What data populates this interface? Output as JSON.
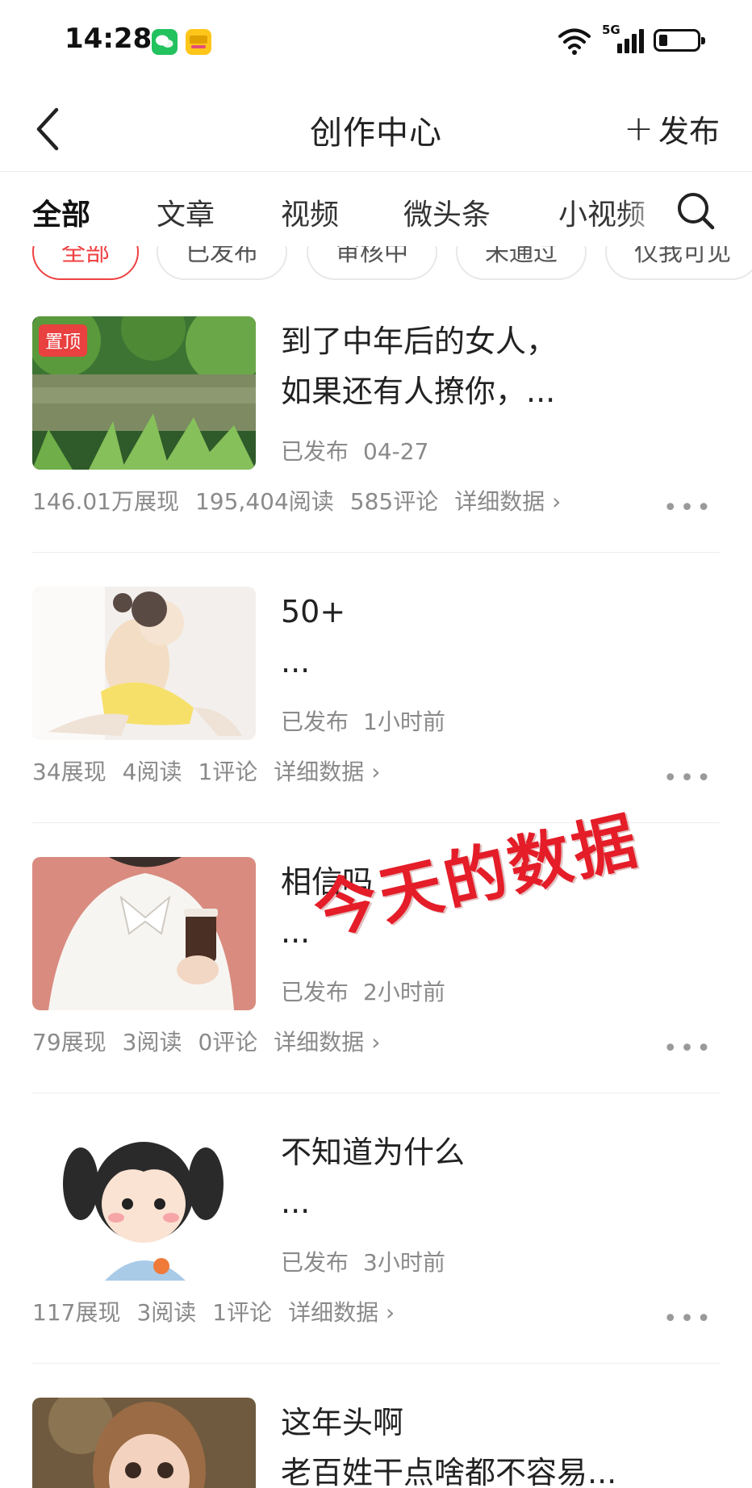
{
  "status_bar": {
    "time": "14:28",
    "network": "5G",
    "apps": [
      "wechat-icon",
      "meituan-icon"
    ]
  },
  "header": {
    "title": "创作中心",
    "publish_label": "发布",
    "back_icon": "chevron-left-icon"
  },
  "tabs": [
    {
      "label": "全部",
      "active": true
    },
    {
      "label": "文章"
    },
    {
      "label": "视频"
    },
    {
      "label": "微头条"
    },
    {
      "label": "小视频"
    }
  ],
  "filters": [
    {
      "label": "全部",
      "active": true
    },
    {
      "label": "已发布"
    },
    {
      "label": "审核中"
    },
    {
      "label": "未通过"
    },
    {
      "label": "仅我可见"
    }
  ],
  "articles": [
    {
      "pinned": true,
      "pinned_label": "置顶",
      "title_line1": "到了中年后的女人，",
      "title_line2": "如果还有人撩你，...",
      "status": "已发布",
      "time": "04-27",
      "impressions": "146.01万展现",
      "reads": "195,404阅读",
      "comments": "585评论",
      "detail": "详细数据",
      "thumb": "lake-trees-photo"
    },
    {
      "title_line1": "50+",
      "title_line2": "...",
      "status": "已发布",
      "time": "1小时前",
      "impressions": "34展现",
      "reads": "4阅读",
      "comments": "1评论",
      "detail": "详细数据",
      "thumb": "yoga-girl-illustration"
    },
    {
      "title_line1": "相信吗",
      "title_line2": "...",
      "status": "已发布",
      "time": "2小时前",
      "impressions": "79展现",
      "reads": "3阅读",
      "comments": "0评论",
      "detail": "详细数据",
      "thumb": "coffee-girl-illustration"
    },
    {
      "title_line1": "不知道为什么",
      "title_line2": "...",
      "status": "已发布",
      "time": "3小时前",
      "impressions": "117展现",
      "reads": "3阅读",
      "comments": "1评论",
      "detail": "详细数据",
      "thumb": "pigtail-girl-illustration"
    },
    {
      "title_line1": "这年头啊",
      "title_line2": "老百姓干点啥都不容易...",
      "thumb": "girl-portrait-illustration"
    }
  ],
  "overlay_text": "今天的数据",
  "colors": {
    "accent": "#f04142",
    "stamp": "#e41d28",
    "muted": "#8a8a8a"
  }
}
